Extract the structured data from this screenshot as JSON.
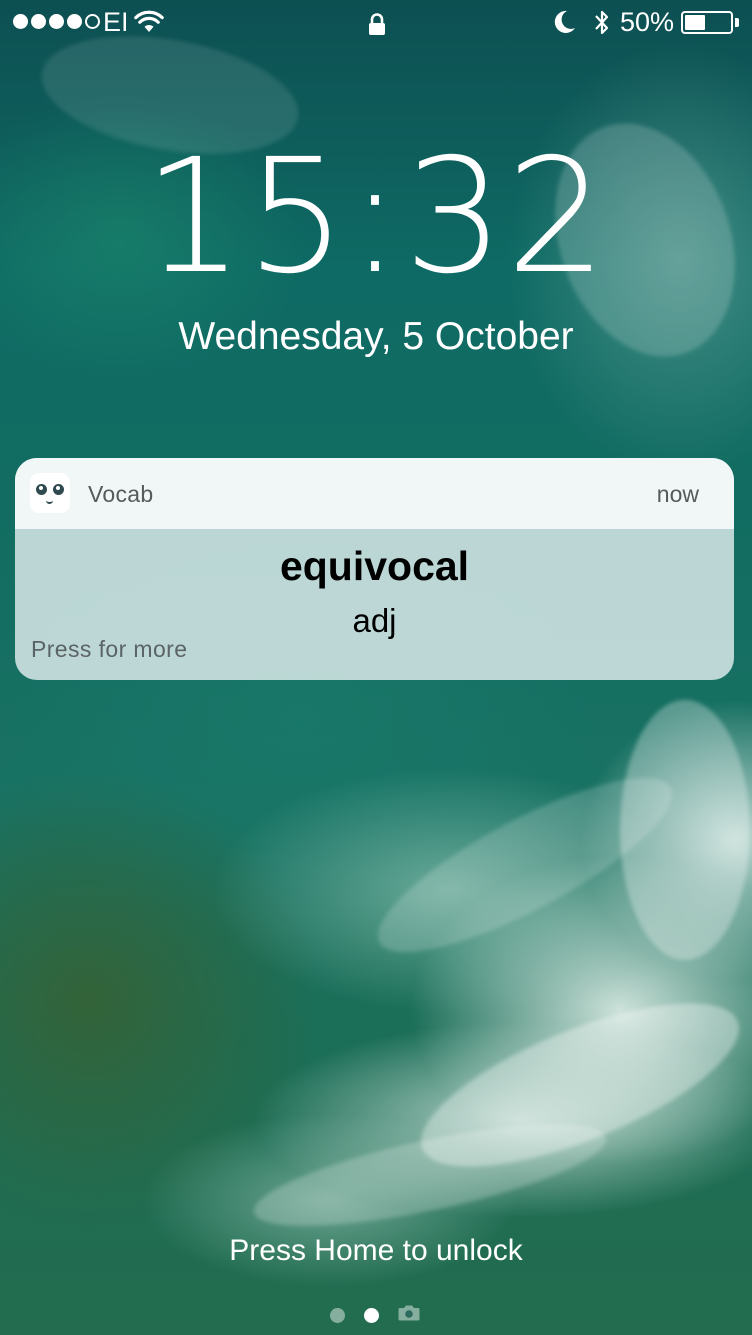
{
  "status_bar": {
    "signal_filled": 4,
    "signal_total": 5,
    "carrier": "EI",
    "battery_percent": "50%",
    "battery_level": 0.5,
    "icons": [
      "wifi-icon",
      "lock-icon",
      "moon-icon",
      "bluetooth-icon",
      "battery-icon"
    ]
  },
  "lock_screen": {
    "time": "15:32",
    "date": "Wednesday, 5 October",
    "unlock_hint": "Press Home to unlock",
    "page_indicator": {
      "pages": [
        "page",
        "page",
        "camera"
      ],
      "active_index": 1
    }
  },
  "notification": {
    "app_name": "Vocab",
    "time": "now",
    "title": "equivocal",
    "body": "adj",
    "action_hint": "Press for more"
  },
  "colors": {
    "notification_bg": "#d7e8e8",
    "notification_header_bg": "#f5f8f8",
    "secondary_text": "#555a5c",
    "ocean_dark": "#0d4f52",
    "ocean_mid": "#197263"
  }
}
